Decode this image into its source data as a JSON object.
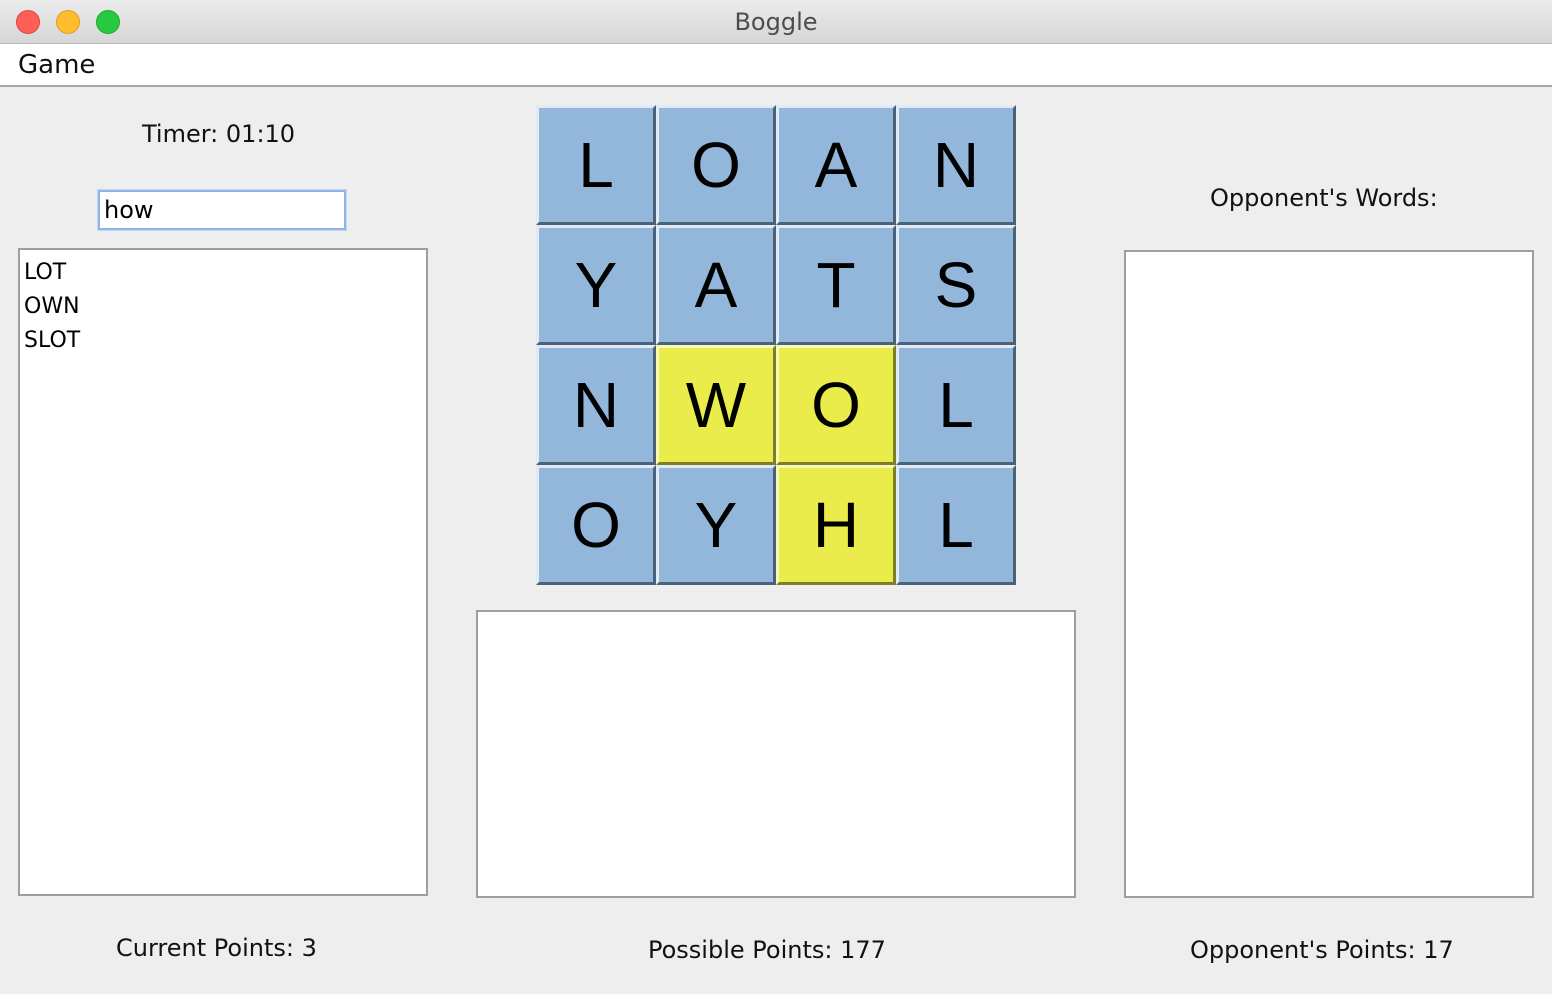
{
  "window": {
    "title": "Boggle"
  },
  "menu": {
    "game_label": "Game"
  },
  "timer": {
    "label": "Timer:",
    "value": "01:10"
  },
  "word_input": {
    "value": "how"
  },
  "player_words": [
    "LOT",
    "OWN",
    "SLOT"
  ],
  "board": {
    "tiles": [
      {
        "letter": "L",
        "selected": false
      },
      {
        "letter": "O",
        "selected": false
      },
      {
        "letter": "A",
        "selected": false
      },
      {
        "letter": "N",
        "selected": false
      },
      {
        "letter": "Y",
        "selected": false
      },
      {
        "letter": "A",
        "selected": false
      },
      {
        "letter": "T",
        "selected": false
      },
      {
        "letter": "S",
        "selected": false
      },
      {
        "letter": "N",
        "selected": false
      },
      {
        "letter": "W",
        "selected": true
      },
      {
        "letter": "O",
        "selected": true
      },
      {
        "letter": "L",
        "selected": false
      },
      {
        "letter": "O",
        "selected": false
      },
      {
        "letter": "Y",
        "selected": false
      },
      {
        "letter": "H",
        "selected": true
      },
      {
        "letter": "L",
        "selected": false
      }
    ],
    "tile_color": "#93b6db",
    "selected_color": "#e9ec4a"
  },
  "opponent": {
    "words_label": "Opponent's Words:",
    "words": [],
    "points_label": "Opponent's Points:",
    "points": "17"
  },
  "scores": {
    "current_label": "Current Points:",
    "current": "3",
    "possible_label": "Possible Points:",
    "possible": "177"
  }
}
